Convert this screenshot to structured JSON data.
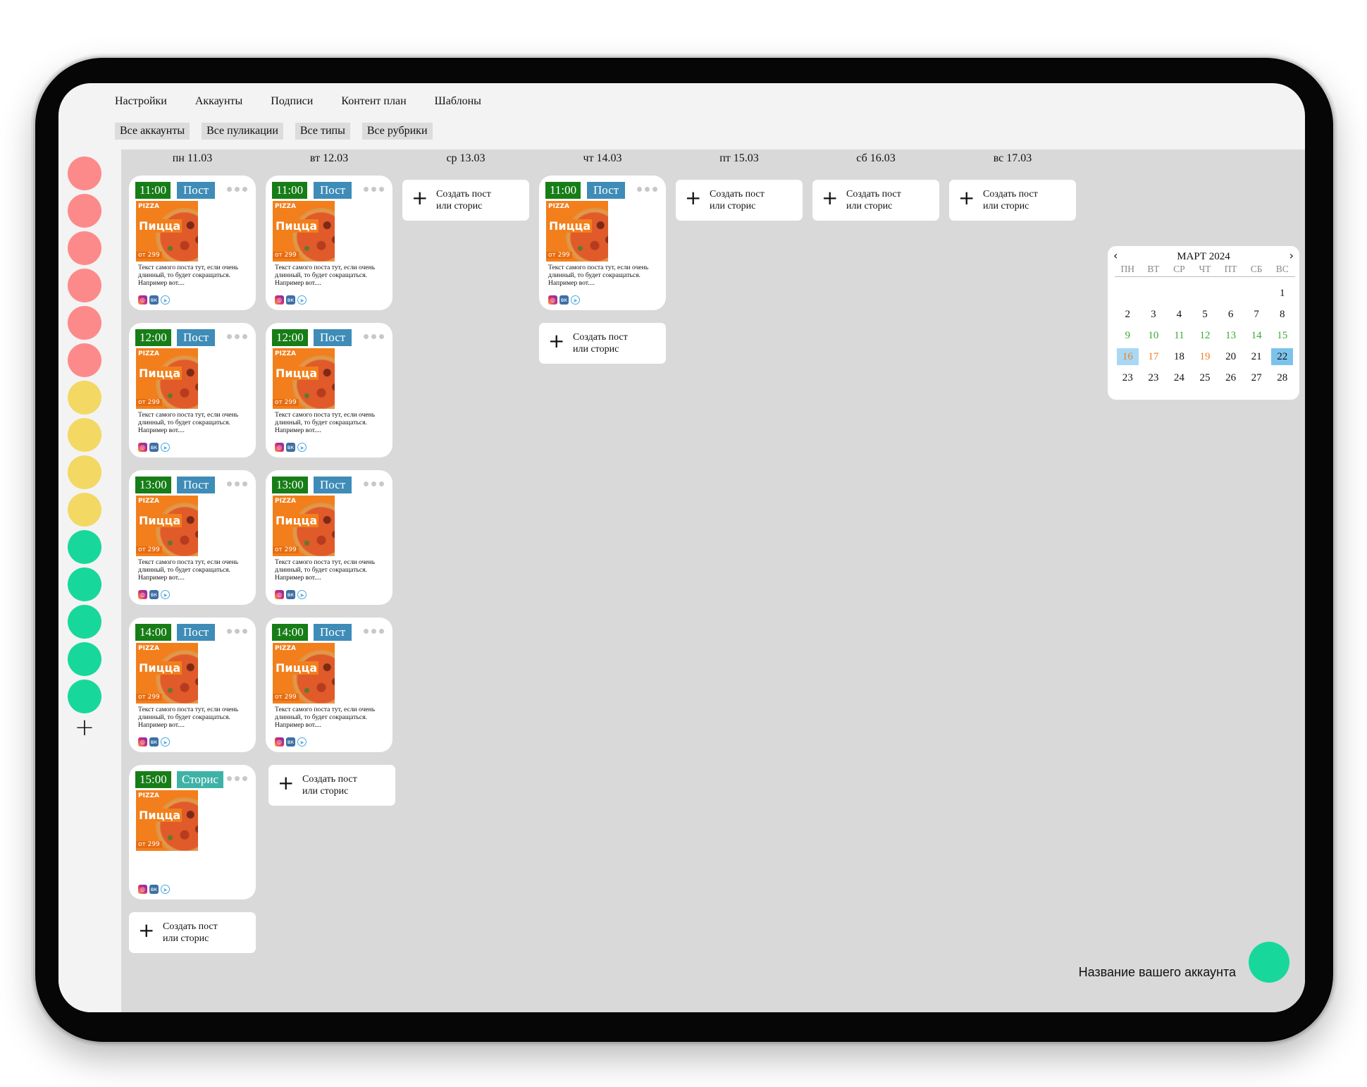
{
  "nav": [
    "Настройки",
    "Аккаунты",
    "Подписи",
    "Контент план",
    "Шаблоны"
  ],
  "filters": [
    "Все аккаунты",
    "Все пуликации",
    "Все типы",
    "Все рубрики"
  ],
  "accounts": [
    "#fd8a8a",
    "#fd8a8a",
    "#fd8a8a",
    "#fd8a8a",
    "#fd8a8a",
    "#fd8a8a",
    "#f3d864",
    "#f3d864",
    "#f3d864",
    "#f3d864",
    "#17d89a",
    "#17d89a",
    "#17d89a",
    "#17d89a",
    "#17d89a"
  ],
  "add_account_label": "+",
  "days": [
    "пн 11.03",
    "вт 12.03",
    "ср 13.03",
    "чт 14.03",
    "пт 15.03",
    "сб 16.03",
    "вс 17.03"
  ],
  "post": {
    "type_post": "Пост",
    "type_story": "Сторис",
    "image_logo": "PIZZA",
    "image_title": "Пицца",
    "image_price": "от 299",
    "text": "Текст самого поста тут, если очень длинный, то будет сокращаться. Например вот....",
    "social": [
      "instagram-icon",
      "vk-icon",
      "telegram-icon"
    ]
  },
  "posts": [
    {
      "day": 0,
      "time": "11:00",
      "kind": "post"
    },
    {
      "day": 0,
      "time": "12:00",
      "kind": "post"
    },
    {
      "day": 0,
      "time": "13:00",
      "kind": "post"
    },
    {
      "day": 0,
      "time": "14:00",
      "kind": "post"
    },
    {
      "day": 0,
      "time": "15:00",
      "kind": "story"
    },
    {
      "day": 1,
      "time": "11:00",
      "kind": "post"
    },
    {
      "day": 1,
      "time": "12:00",
      "kind": "post"
    },
    {
      "day": 1,
      "time": "13:00",
      "kind": "post"
    },
    {
      "day": 1,
      "time": "14:00",
      "kind": "post"
    },
    {
      "day": 3,
      "time": "11:00",
      "kind": "post"
    }
  ],
  "create_label_1": "Создать пост",
  "create_label_2": "или сторис",
  "calendar": {
    "title": "МАРТ 2024",
    "prev": "‹",
    "next": "›",
    "weekdays": [
      "ПН",
      "ВТ",
      "СР",
      "ЧТ",
      "ПТ",
      "СБ",
      "ВС"
    ],
    "rows": [
      [
        {
          "d": ""
        },
        {
          "d": ""
        },
        {
          "d": ""
        },
        {
          "d": ""
        },
        {
          "d": ""
        },
        {
          "d": ""
        },
        {
          "d": "1"
        }
      ],
      [
        {
          "d": "2"
        },
        {
          "d": "3"
        },
        {
          "d": "4"
        },
        {
          "d": "5"
        },
        {
          "d": "6"
        },
        {
          "d": "7"
        },
        {
          "d": "8"
        }
      ],
      [
        {
          "d": "9",
          "c": "#3aa935"
        },
        {
          "d": "10",
          "c": "#3aa935"
        },
        {
          "d": "11",
          "c": "#3aa935"
        },
        {
          "d": "12",
          "c": "#3aa935"
        },
        {
          "d": "13",
          "c": "#3aa935"
        },
        {
          "d": "14",
          "c": "#3aa935"
        },
        {
          "d": "15",
          "c": "#3aa935"
        }
      ],
      [
        {
          "d": "16",
          "c": "#f07d22",
          "bg": "#a9d8f5"
        },
        {
          "d": "17",
          "c": "#f07d22"
        },
        {
          "d": "18"
        },
        {
          "d": "19",
          "c": "#f07d22"
        },
        {
          "d": "20"
        },
        {
          "d": "21"
        },
        {
          "d": "22",
          "bg": "#7cc3ec"
        }
      ],
      [
        {
          "d": "23"
        },
        {
          "d": "23"
        },
        {
          "d": "24"
        },
        {
          "d": "25"
        },
        {
          "d": "26"
        },
        {
          "d": "27"
        },
        {
          "d": "28"
        }
      ]
    ]
  },
  "account_name": "Название вашего аккаунта",
  "account_color": "#17d89a"
}
